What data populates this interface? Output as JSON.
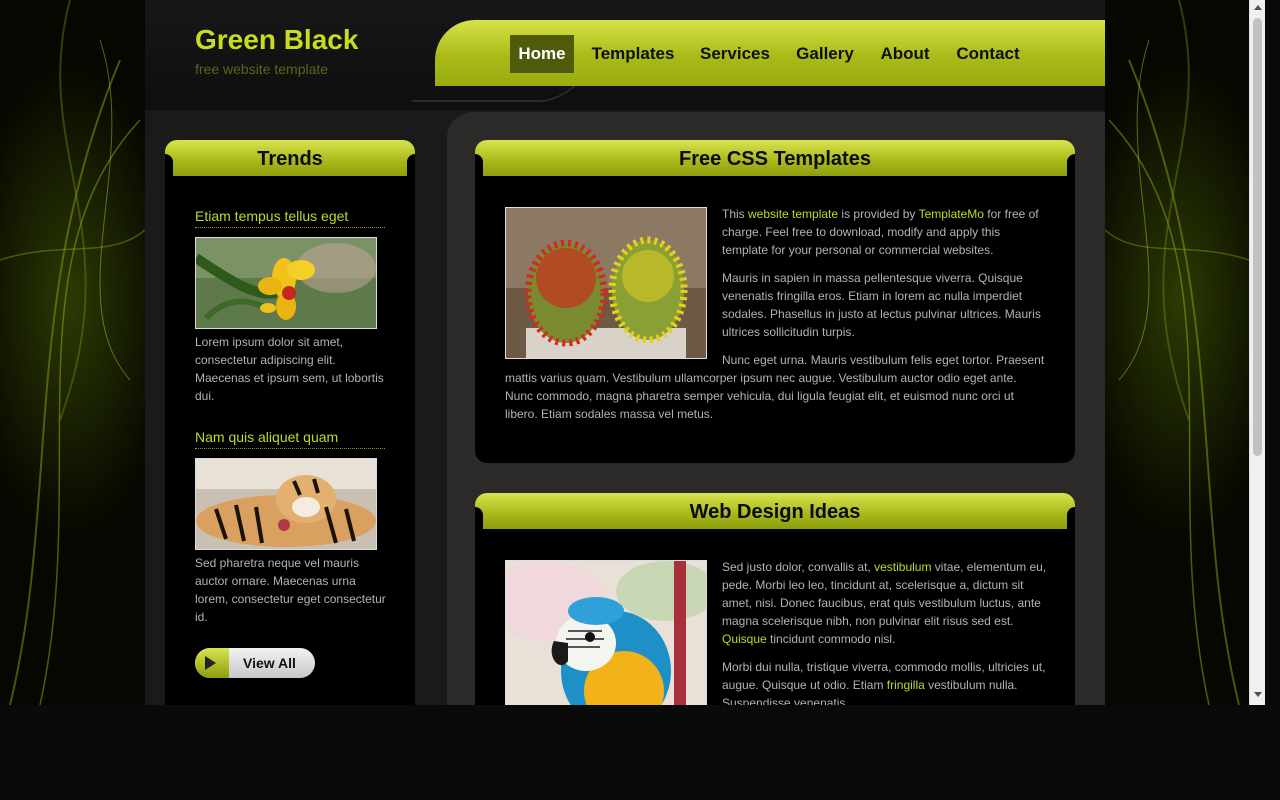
{
  "header": {
    "site_title": "Green Black",
    "site_slogan": "free website template"
  },
  "nav": {
    "items": [
      "Home",
      "Templates",
      "Services",
      "Gallery",
      "About",
      "Contact"
    ],
    "active": "Home"
  },
  "sidebar": {
    "title": "Trends",
    "items": [
      {
        "title": "Etiam tempus tellus eget",
        "image": "orchid-flower-photo",
        "text": "Lorem ipsum dolor sit amet, consectetur adipiscing elit. Maecenas et ipsum sem, ut lobortis dui."
      },
      {
        "title": "Nam quis aliquet quam",
        "image": "tiger-photo",
        "text": "Sed pharetra neque vel mauris auctor ornare. Maecenas urna lorem, consectetur eget consectetur id."
      }
    ],
    "view_all_label": "View All"
  },
  "articles": [
    {
      "title": "Free CSS Templates",
      "image": "cactus-photo",
      "p1": {
        "t1": "This ",
        "link1": "website template",
        "t2": " is provided by ",
        "link2": "TemplateMo",
        "t3": " for free of charge. Feel free to download, modify and apply this template for your personal or commercial websites."
      },
      "p2": "Mauris in sapien in massa pellentesque viverra. Quisque venenatis fringilla eros. Etiam in lorem ac nulla imperdiet sodales. Phasellus in justo at lectus pulvinar ultrices. Mauris ultrices sollicitudin turpis.",
      "p3a": "Nunc eget urna. Mauris vestibulum felis eget tortor. Praesent",
      "p3b": "mattis varius quam. Vestibulum ullamcorper ipsum nec augue. Vestibulum auctor odio eget ante. Nunc commodo, magna pharetra semper vehicula, dui ligula feugiat elit, et euismod nunc orci ut libero. Etiam sodales massa vel metus."
    },
    {
      "title": "Web Design Ideas",
      "image": "parrot-photo",
      "p1": {
        "t1": "Sed justo dolor, convallis at, ",
        "link1": "vestibulum",
        "t2": " vitae, elementum eu, pede. Morbi leo leo, tincidunt at, scelerisque a, dictum sit amet, nisi. Donec faucibus, erat quis vestibulum luctus, ante magna scelerisque nibh, non pulvinar elit risus sed est. ",
        "link2": "Quisque",
        "t3": " tincidunt commodo nisl."
      },
      "p2": {
        "t1": "Morbi dui nulla, tristique viverra, commodo mollis, ultricies ut, augue. Quisque ut odio. Etiam ",
        "link1": "fringilla",
        "t2": " vestibulum nulla. Suspendisse venenatis."
      }
    }
  ],
  "colors": {
    "accent": "#c3d629",
    "nav_active_bg": "#4f5b0b",
    "panel_bg": "#000000",
    "page_bg": "#0a0a0a"
  }
}
